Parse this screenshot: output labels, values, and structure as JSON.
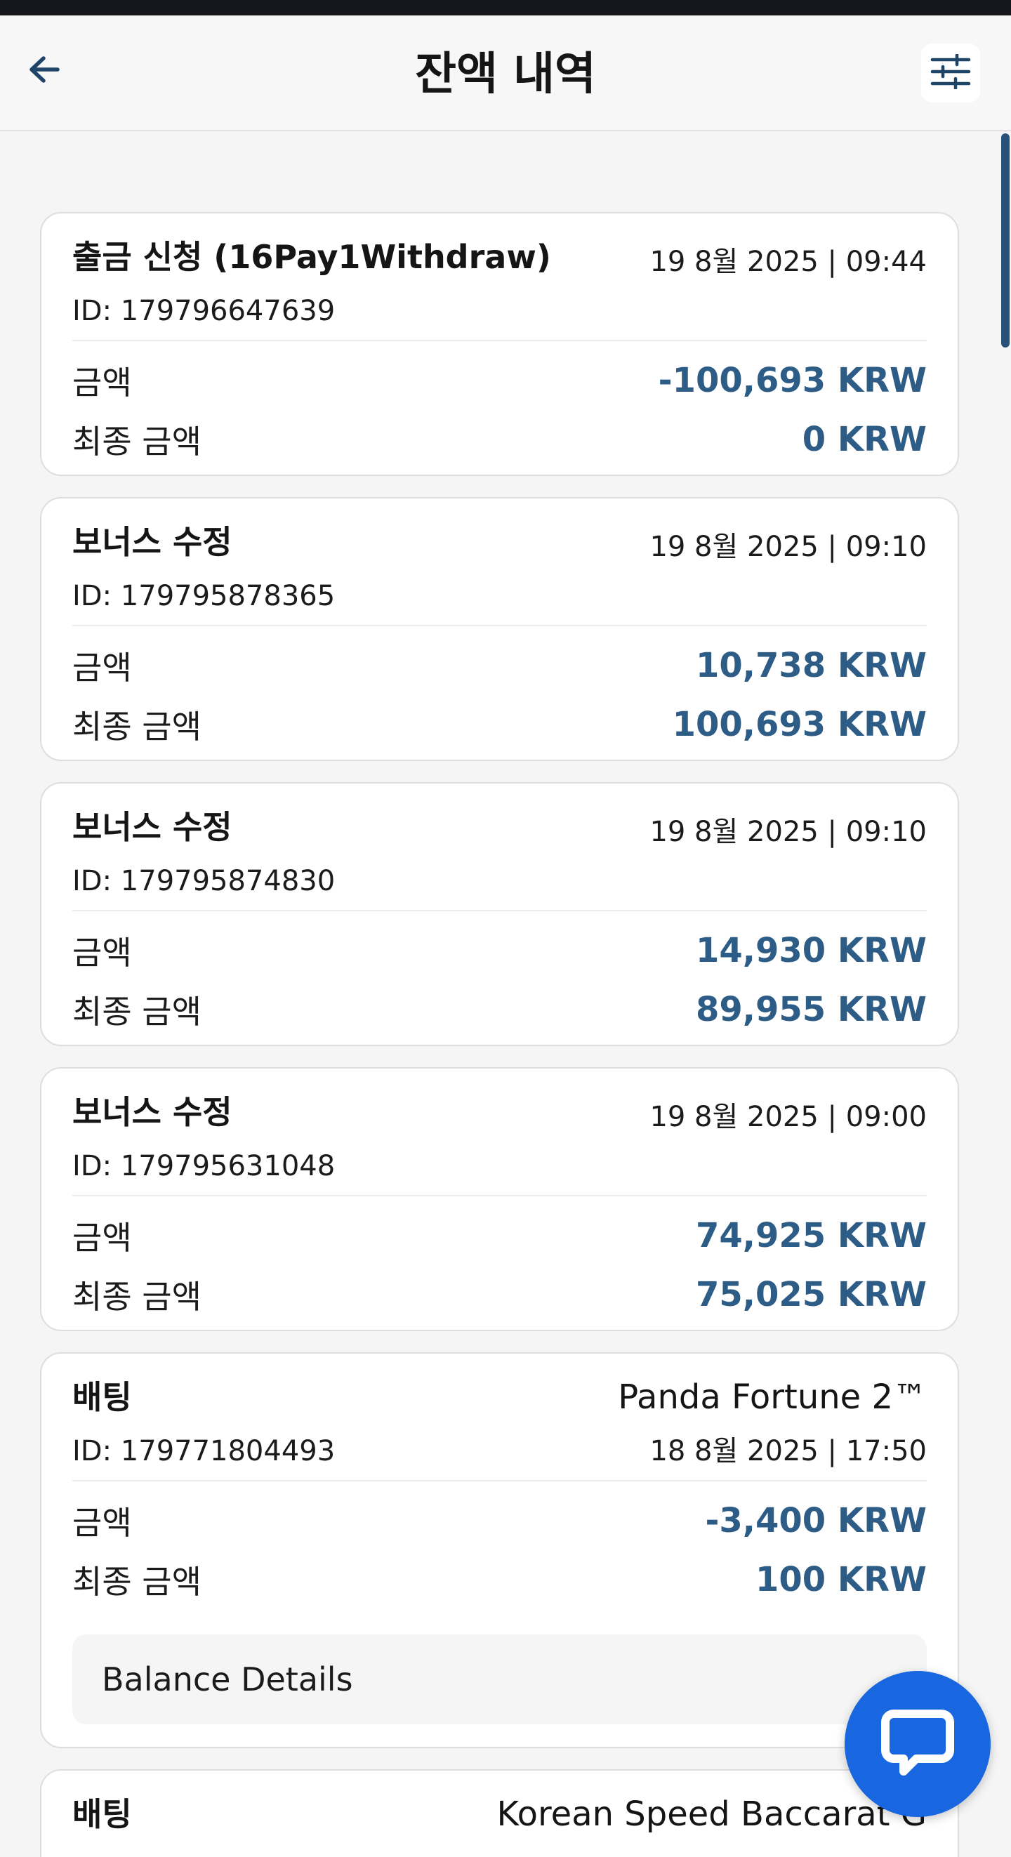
{
  "header": {
    "title": "잔액 내역",
    "back_icon": "arrow-left-icon",
    "filter_icon": "sliders-icon"
  },
  "transactions": [
    {
      "type": "출금 신청 (16Pay1Withdraw)",
      "id": "ID: 179796647639",
      "date": "19 8월 2025 | 09:44",
      "amount_label": "금액",
      "amount": "-100,693 KRW",
      "final_label": "최종 금액",
      "final": "0 KRW"
    },
    {
      "type": "보너스 수정",
      "id": "ID: 179795878365",
      "date": "19 8월 2025 | 09:10",
      "amount_label": "금액",
      "amount": "10,738 KRW",
      "final_label": "최종 금액",
      "final": "100,693 KRW"
    },
    {
      "type": "보너스 수정",
      "id": "ID: 179795874830",
      "date": "19 8월 2025 | 09:10",
      "amount_label": "금액",
      "amount": "14,930 KRW",
      "final_label": "최종 금액",
      "final": "89,955 KRW"
    },
    {
      "type": "보너스 수정",
      "id": "ID: 179795631048",
      "date": "19 8월 2025 | 09:00",
      "amount_label": "금액",
      "amount": "74,925 KRW",
      "final_label": "최종 금액",
      "final": "75,025 KRW"
    },
    {
      "type": "배팅",
      "game": "Panda Fortune 2™",
      "id": "ID: 179771804493",
      "date": "18 8월 2025 | 17:50",
      "amount_label": "금액",
      "amount": "-3,400 KRW",
      "final_label": "최종 금액",
      "final": "100 KRW",
      "details_label": "Balance Details"
    },
    {
      "type": "배팅",
      "game": "Korean Speed Baccarat G"
    }
  ],
  "chat": {
    "icon": "chat-bubble-icon"
  },
  "colors": {
    "accent_value": "#2d5c86",
    "chat_button": "#1967e0",
    "scrollbar": "#28527a"
  }
}
